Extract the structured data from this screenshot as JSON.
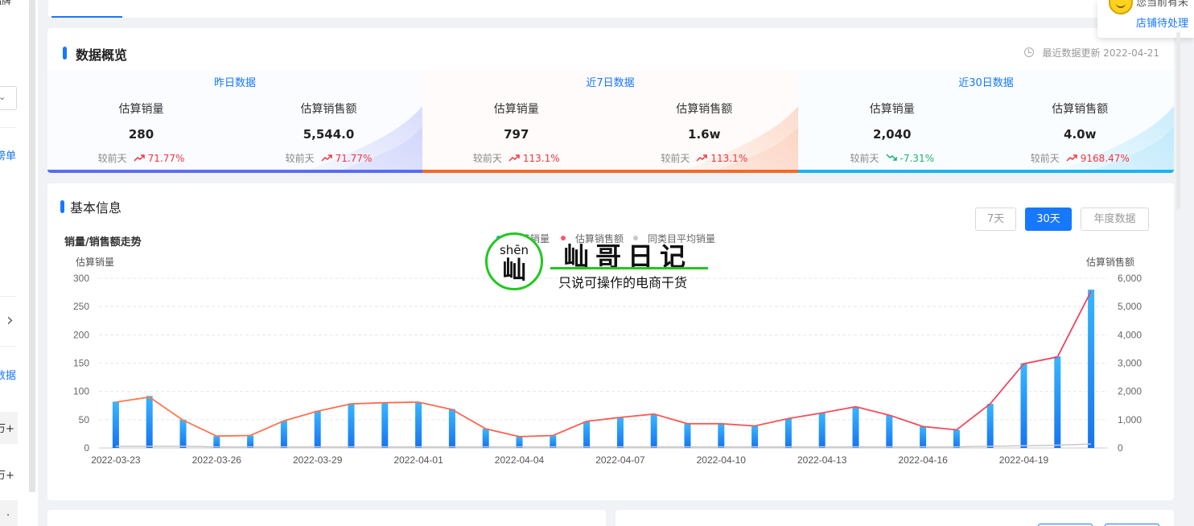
{
  "sidebar": {
    "fragment_top": "品牌",
    "fragment_rank": "榜单",
    "fragment_data": "数据",
    "fragment_item1": "万+",
    "fragment_item2": "万+",
    "chevron": "›",
    "select_caret": "⌄",
    "dot": "."
  },
  "notification": {
    "title": "您当前有未",
    "link": "店铺待处理"
  },
  "overview": {
    "title": "数据概览",
    "update_label": "最近数据更新 2022-04-21",
    "periods": [
      {
        "label": "昨日数据",
        "accent": "#5b6cf0",
        "metrics": [
          {
            "label": "估算销量",
            "value": "280",
            "compare_label": "较前天",
            "change": "71.77%",
            "direction": "up"
          },
          {
            "label": "估算销售额",
            "value": "5,544.0",
            "compare_label": "较前天",
            "change": "71.77%",
            "direction": "up"
          }
        ]
      },
      {
        "label": "近7日数据",
        "accent": "#f26a2a",
        "metrics": [
          {
            "label": "估算销量",
            "value": "797",
            "compare_label": "较前天",
            "change": "113.1%",
            "direction": "up"
          },
          {
            "label": "估算销售额",
            "value": "1.6w",
            "compare_label": "较前天",
            "change": "113.1%",
            "direction": "up"
          }
        ]
      },
      {
        "label": "近30日数据",
        "accent": "#1cb4f0",
        "metrics": [
          {
            "label": "估算销量",
            "value": "2,040",
            "compare_label": "较前天",
            "change": "-7.31%",
            "direction": "down"
          },
          {
            "label": "估算销售额",
            "value": "4.0w",
            "compare_label": "较前天",
            "change": "9168.47%",
            "direction": "up"
          }
        ]
      }
    ]
  },
  "basic_info": {
    "title": "基本信息",
    "range_buttons": [
      {
        "label": "7天",
        "active": false
      },
      {
        "label": "30天",
        "active": true
      },
      {
        "label": "年度数据",
        "active": false
      }
    ],
    "chart_title": "销量/销售额走势"
  },
  "watermark": {
    "pinyin": "shēn",
    "char": "屾",
    "name": "屾哥日记",
    "slogan": "只说可操作的电商干货"
  },
  "chart_data": {
    "type": "bar",
    "ylabel": "估算销量",
    "y2label": "估算销售额",
    "ylim": [
      0,
      300
    ],
    "y2lim": [
      0,
      6000
    ],
    "yticks": [
      0,
      50,
      100,
      150,
      200,
      250,
      300
    ],
    "y2ticks": [
      0,
      1000,
      2000,
      3000,
      4000,
      5000,
      6000
    ],
    "y2tick_labels": [
      "0",
      "1,000",
      "2,000",
      "3,000",
      "4,000",
      "5,000",
      "6,000"
    ],
    "grid": true,
    "legend_position": "top",
    "categories": [
      "2022-03-23",
      "2022-03-24",
      "2022-03-25",
      "2022-03-26",
      "2022-03-27",
      "2022-03-28",
      "2022-03-29",
      "2022-03-30",
      "2022-03-31",
      "2022-04-01",
      "2022-04-02",
      "2022-04-03",
      "2022-04-04",
      "2022-04-05",
      "2022-04-06",
      "2022-04-07",
      "2022-04-08",
      "2022-04-09",
      "2022-04-10",
      "2022-04-11",
      "2022-04-12",
      "2022-04-13",
      "2022-04-14",
      "2022-04-15",
      "2022-04-16",
      "2022-04-17",
      "2022-04-18",
      "2022-04-19",
      "2022-04-20",
      "2022-04-21"
    ],
    "xtick_labels": [
      "2022-03-23",
      "2022-03-26",
      "2022-03-29",
      "2022-04-01",
      "2022-04-04",
      "2022-04-07",
      "2022-04-10",
      "2022-04-13",
      "2022-04-16",
      "2022-04-19"
    ],
    "series": [
      {
        "name": "估算销量",
        "type": "bar",
        "axis": "left",
        "color": "#1e90ff",
        "values": [
          82,
          92,
          50,
          21,
          22,
          48,
          66,
          79,
          80,
          81,
          69,
          34,
          20,
          22,
          47,
          54,
          60,
          43,
          43,
          39,
          52,
          62,
          73,
          58,
          38,
          32,
          78,
          150,
          162,
          280
        ]
      },
      {
        "name": "估算销售额",
        "type": "line",
        "axis": "right",
        "color": "#f25c6e",
        "values": [
          1620,
          1800,
          980,
          420,
          440,
          960,
          1300,
          1560,
          1600,
          1620,
          1360,
          680,
          400,
          440,
          940,
          1080,
          1200,
          860,
          860,
          780,
          1040,
          1240,
          1460,
          1160,
          760,
          640,
          1560,
          2980,
          3220,
          5544
        ]
      },
      {
        "name": "同类目平均销量",
        "type": "line",
        "axis": "left",
        "color": "#c8c8c8",
        "values": [
          3,
          3,
          3,
          2,
          2,
          2,
          2,
          2,
          2,
          2,
          2,
          2,
          2,
          2,
          2,
          2,
          2,
          2,
          2,
          2,
          2,
          2,
          2,
          2,
          2,
          2,
          3,
          4,
          5,
          7
        ]
      }
    ]
  }
}
